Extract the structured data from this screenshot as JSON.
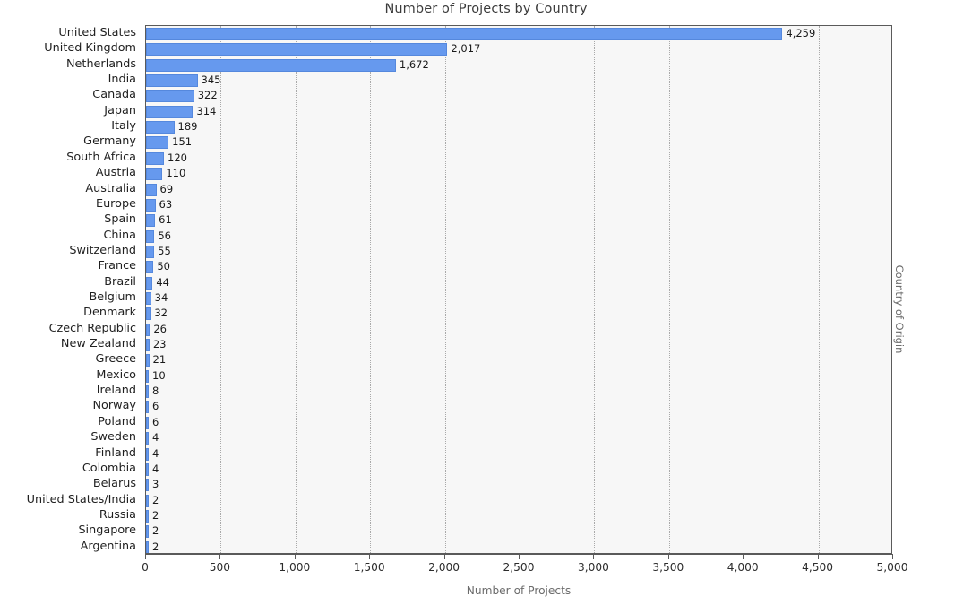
{
  "chart_data": {
    "type": "bar",
    "orientation": "horizontal",
    "title": "Number of Projects by Country",
    "xlabel": "Number of Projects",
    "ylabel": "Country of Origin",
    "xlim": [
      0,
      5000
    ],
    "xticks": [
      0,
      500,
      1000,
      1500,
      2000,
      2500,
      3000,
      3500,
      4000,
      4500,
      5000
    ],
    "xtick_labels": [
      "0",
      "500",
      "1,000",
      "1,500",
      "2,000",
      "2,500",
      "3,000",
      "3,500",
      "4,000",
      "4,500",
      "5,000"
    ],
    "grid": "vertical-dotted",
    "legend": null,
    "bar_color": "#6699ee",
    "bar_border_color": "#5588dd",
    "plot_background": "#f7f7f7",
    "categories": [
      "United States",
      "United Kingdom",
      "Netherlands",
      "India",
      "Canada",
      "Japan",
      "Italy",
      "Germany",
      "South Africa",
      "Austria",
      "Australia",
      "Europe",
      "Spain",
      "China",
      "Switzerland",
      "France",
      "Brazil",
      "Belgium",
      "Denmark",
      "Czech Republic",
      "New Zealand",
      "Greece",
      "Mexico",
      "Ireland",
      "Norway",
      "Poland",
      "Sweden",
      "Finland",
      "Colombia",
      "Belarus",
      "United States/India",
      "Russia",
      "Singapore",
      "Argentina"
    ],
    "values": [
      4259,
      2017,
      1672,
      345,
      322,
      314,
      189,
      151,
      120,
      110,
      69,
      63,
      61,
      56,
      55,
      50,
      44,
      34,
      32,
      26,
      23,
      21,
      10,
      8,
      6,
      6,
      4,
      4,
      4,
      3,
      2,
      2,
      2,
      2
    ],
    "value_labels": [
      "4,259",
      "2,017",
      "1,672",
      "345",
      "322",
      "314",
      "189",
      "151",
      "120",
      "110",
      "69",
      "63",
      "61",
      "56",
      "55",
      "50",
      "44",
      "34",
      "32",
      "26",
      "23",
      "21",
      "10",
      "8",
      "6",
      "6",
      "4",
      "4",
      "4",
      "3",
      "2",
      "2",
      "2",
      "2"
    ]
  }
}
